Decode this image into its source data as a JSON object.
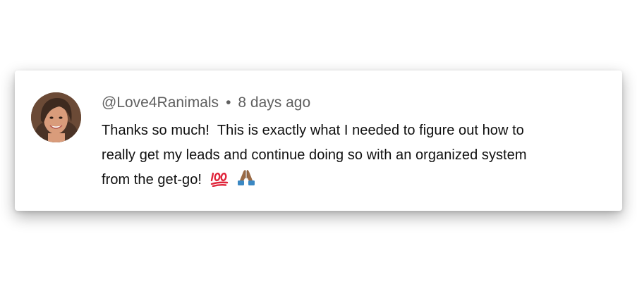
{
  "comment": {
    "author": "@Love4Ranimals",
    "separator": "•",
    "timestamp": "8 days ago",
    "lines": [
      "Thanks so much!  This is exactly what I needed to figure out how to",
      "really get my leads and continue doing so with an organized system",
      "from the get-go!"
    ],
    "emojis": [
      "hundred-points-emoji",
      "folded-hands-emoji"
    ],
    "avatar": "profile-photo"
  },
  "colors": {
    "meta_text": "#606060",
    "body_text": "#0f0f0f",
    "hundred_red": "#e0243a",
    "hands": "#9a6a45",
    "cuff": "#3b88c3"
  }
}
